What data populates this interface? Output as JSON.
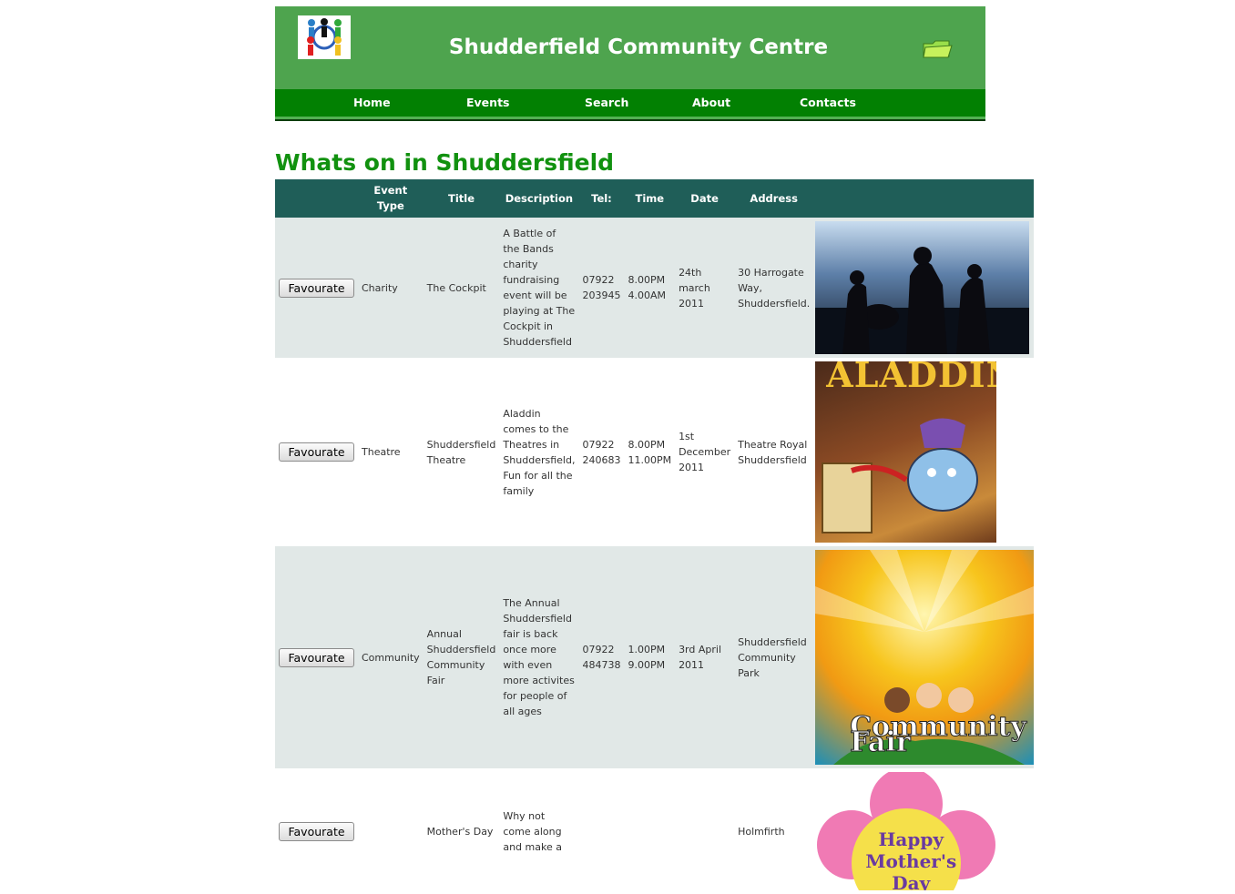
{
  "site": {
    "title": "Shudderfield Community Centre"
  },
  "nav": [
    "Home",
    "Events",
    "Search",
    "About",
    "Contacts"
  ],
  "page": {
    "heading": "Whats on in Shuddersfield"
  },
  "table": {
    "headers": [
      "",
      "Event Type",
      "Title",
      "Description",
      "Tel:",
      "Time",
      "Date",
      "Address",
      ""
    ],
    "button_label": "Favourate",
    "rows": [
      {
        "type": "Charity",
        "title": "The Cockpit",
        "description": "A Battle of the Bands charity fundraising event will be playing at The Cockpit in Shuddersfield",
        "tel": "07922 203945",
        "time": "8.00PM 4.00AM",
        "date": "24th march 2011",
        "address": "30 Harrogate Way, Shuddersfield.",
        "image_text": ""
      },
      {
        "type": "Theatre",
        "title": "Shuddersfield Theatre",
        "description": "Aladdin comes to the Theatres in Shuddersfield, Fun for all the family",
        "tel": "07922 240683",
        "time": "8.00PM 11.00PM",
        "date": "1st December 2011",
        "address": "Theatre Royal Shuddersfield",
        "image_text": "ALADDIN"
      },
      {
        "type": "Community",
        "title": "Annual Shuddersfield Community Fair",
        "description": "The Annual Shuddersfield fair is back once more with even more activites for people of all ages",
        "tel": "07922 484738",
        "time": "1.00PM 9.00PM",
        "date": "3rd April 2011",
        "address": "Shuddersfield Community Park",
        "image_text": "Community Fair"
      },
      {
        "type": "",
        "title": "Mother's Day",
        "description": "Why not come along and make a",
        "tel": "",
        "time": "",
        "date": "",
        "address": "Holmfirth",
        "image_text": "Happy Mother's Day"
      }
    ]
  },
  "colors": {
    "header_bg": "#4ea44e",
    "nav_bg": "#028002",
    "heading": "#11910f",
    "table_header_bg": "#1f5e58",
    "row_alt_bg": "#e1e8e7"
  }
}
